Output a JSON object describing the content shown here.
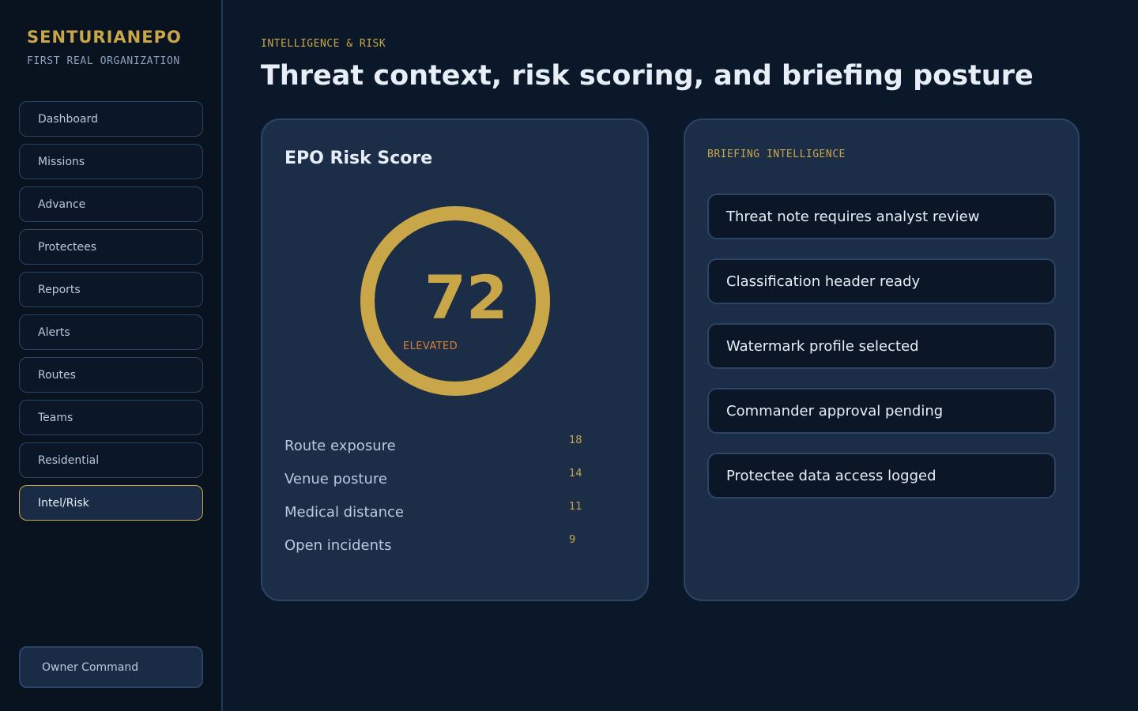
{
  "brand": {
    "name": "SENTURIANEPO",
    "subtitle": "FIRST REAL ORGANIZATION"
  },
  "nav": {
    "items": [
      {
        "label": "Dashboard"
      },
      {
        "label": "Missions"
      },
      {
        "label": "Advance"
      },
      {
        "label": "Protectees"
      },
      {
        "label": "Reports"
      },
      {
        "label": "Alerts"
      },
      {
        "label": "Routes"
      },
      {
        "label": "Teams"
      },
      {
        "label": "Residential"
      },
      {
        "label": "Intel/Risk",
        "active": true
      }
    ],
    "owner_label": "Owner Command"
  },
  "header": {
    "eyebrow": "INTELLIGENCE & RISK",
    "title": "Threat context, risk scoring, and briefing posture"
  },
  "risk": {
    "title": "EPO Risk Score",
    "score": "72",
    "level": "ELEVATED",
    "factors": [
      {
        "name": "Route exposure",
        "value": "18"
      },
      {
        "name": "Venue posture",
        "value": "14"
      },
      {
        "name": "Medical distance",
        "value": "11"
      },
      {
        "name": "Open incidents",
        "value": "9"
      }
    ]
  },
  "briefing": {
    "eyebrow": "BRIEFING INTELLIGENCE",
    "items": [
      "Threat note requires analyst review",
      "Classification header ready",
      "Watermark profile selected",
      "Commander approval pending",
      "Protectee data access logged"
    ]
  },
  "colors": {
    "accent": "#c9a748",
    "warning": "#d4803a",
    "background": "#0b1829",
    "card": "#1c2d47"
  }
}
